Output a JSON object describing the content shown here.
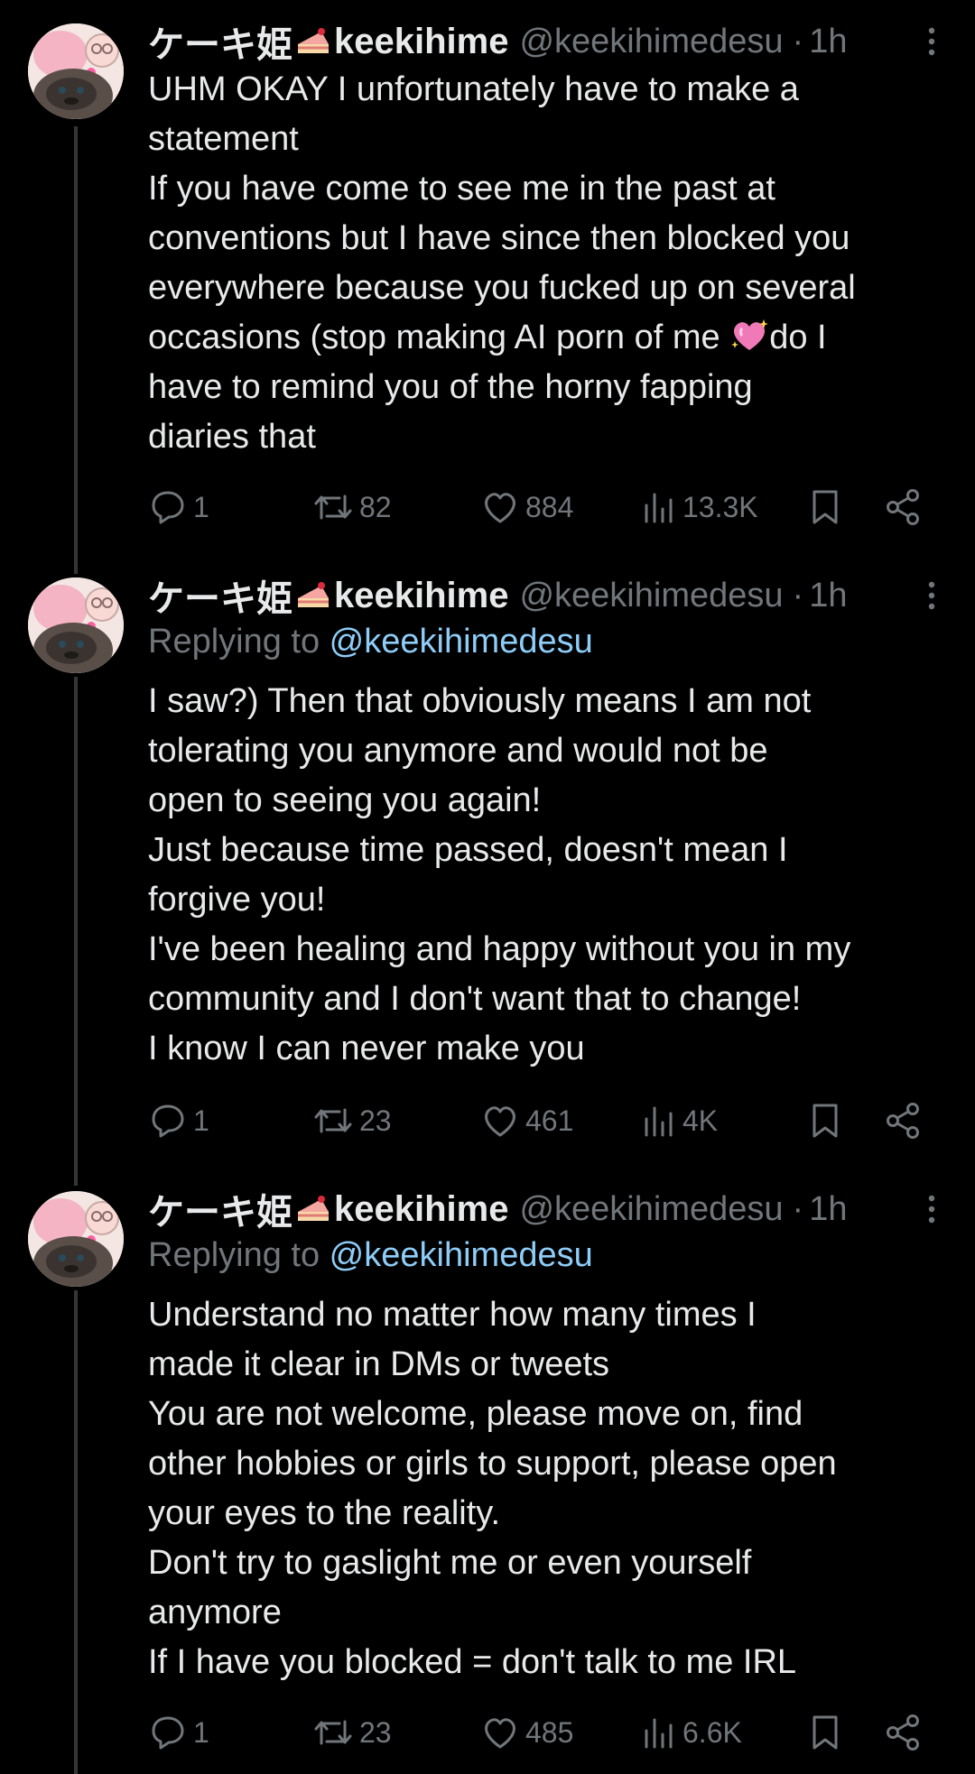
{
  "colors": {
    "background": "#000000",
    "text": "#e7e9ea",
    "muted": "#71767b",
    "mention": "#8ecdf8",
    "thread_line": "#333639",
    "heart_emoji": "#f07ab8"
  },
  "tweets": [
    {
      "author": {
        "name_prefix": "ケーキ姫",
        "name_emoji": "cake-slice-icon",
        "name_suffix": "keekihime",
        "handle": "@keekihimedesu",
        "time": "1h"
      },
      "replying_to": null,
      "body": [
        "UHM OKAY I unfortunately have to make a",
        "statement",
        "If you have come to see me in the past at",
        "conventions but I have since then blocked you",
        "everywhere because you fucked up on several",
        {
          "before": "occasions (stop making AI porn of me ",
          "emoji": "sparkling-heart-icon",
          "after": "do I"
        },
        "have to remind you of the horny fapping",
        "diaries that"
      ],
      "stats": {
        "replies": "1",
        "reposts": "82",
        "likes": "884",
        "views": "13.3K"
      }
    },
    {
      "author": {
        "name_prefix": "ケーキ姫",
        "name_emoji": "cake-slice-icon",
        "name_suffix": "keekihime",
        "handle": "@keekihimedesu",
        "time": "1h"
      },
      "replying_to": {
        "label": "Replying to ",
        "mention": "@keekihimedesu"
      },
      "body": [
        "I saw?) Then that obviously means I am not",
        "tolerating you anymore and would not be",
        "open to seeing you again!",
        "Just because time passed, doesn't mean I",
        "forgive you!",
        "I've been healing and happy without you in my",
        "community and I don't want that to change!",
        "I know I can never make you"
      ],
      "stats": {
        "replies": "1",
        "reposts": "23",
        "likes": "461",
        "views": "4K"
      }
    },
    {
      "author": {
        "name_prefix": "ケーキ姫",
        "name_emoji": "cake-slice-icon",
        "name_suffix": "keekihime",
        "handle": "@keekihimedesu",
        "time": "1h"
      },
      "replying_to": {
        "label": "Replying to ",
        "mention": "@keekihimedesu"
      },
      "body": [
        "Understand no matter how many times I",
        "made it clear in DMs or tweets",
        "You are not welcome, please move on, find",
        "other hobbies or girls to support, please open",
        "your eyes to the reality.",
        "Don't try to gaslight me or even yourself",
        "anymore",
        "If I have you blocked = don't talk to me IRL"
      ],
      "stats": {
        "replies": "1",
        "reposts": "23",
        "likes": "485",
        "views": "6.6K"
      }
    }
  ]
}
